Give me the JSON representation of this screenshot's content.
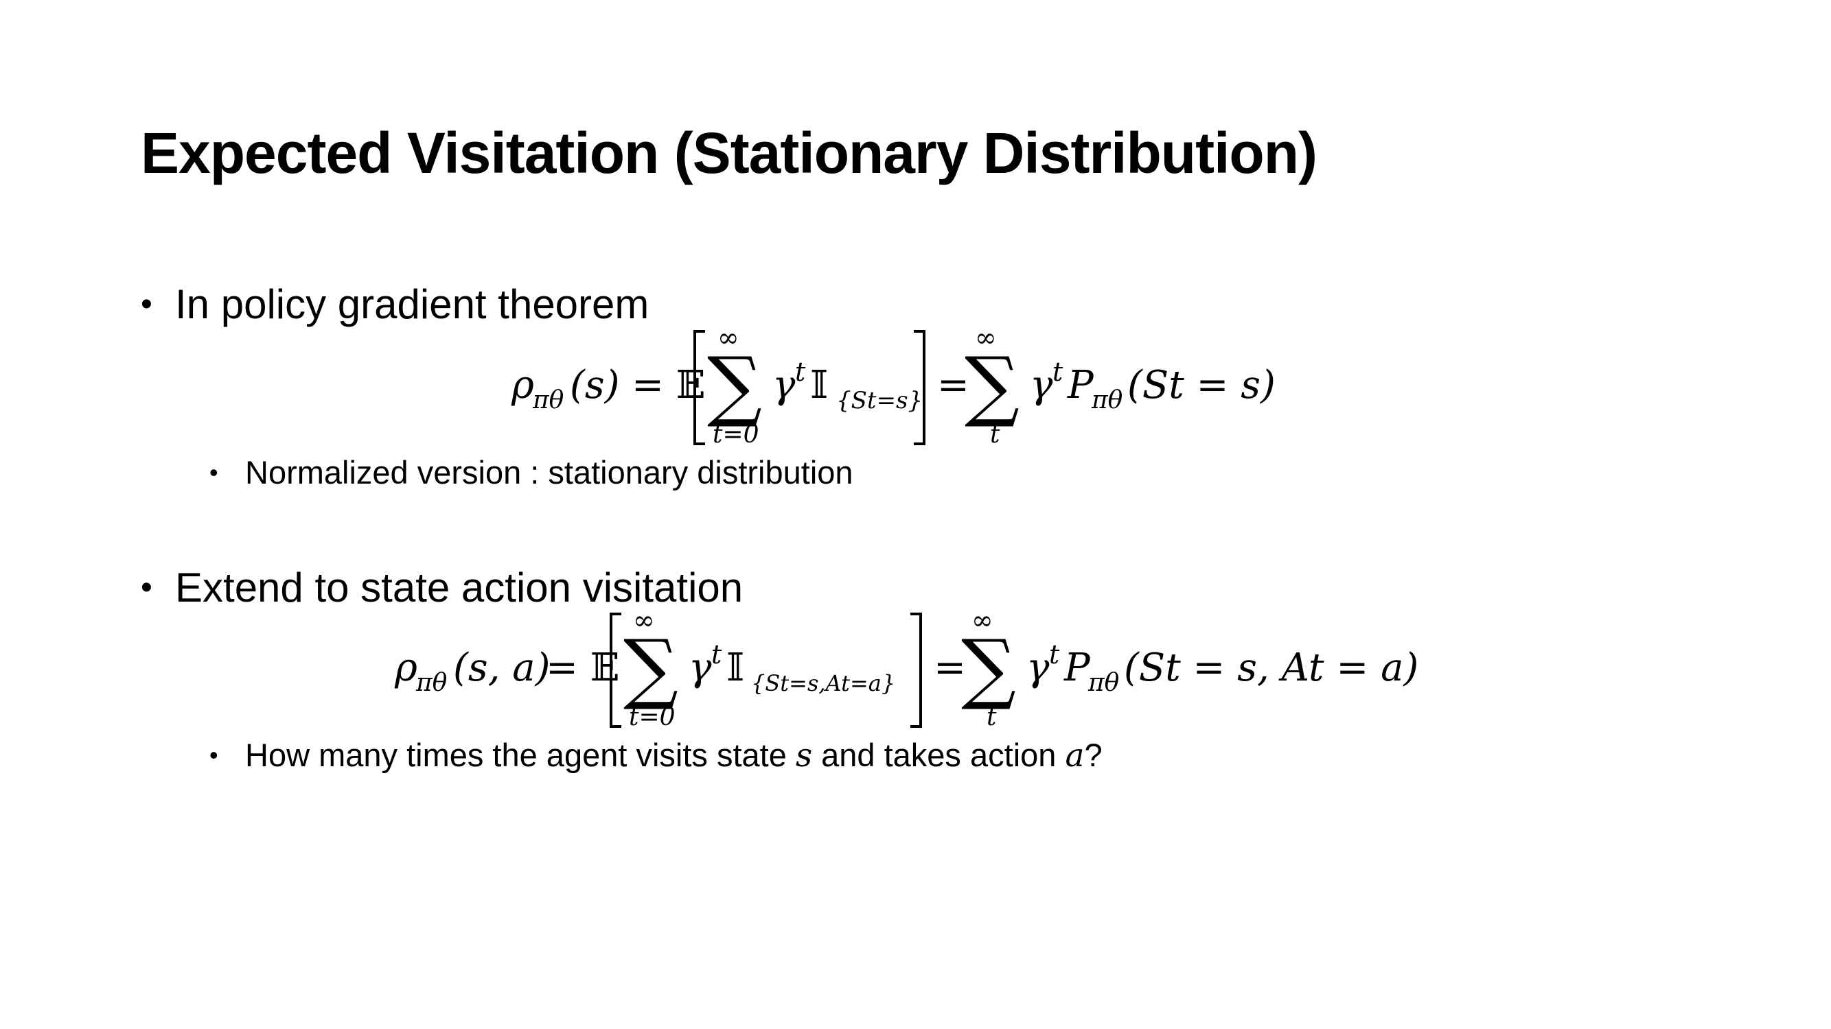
{
  "slide": {
    "title": "Expected Visitation (Stationary Distribution)",
    "bullets": [
      {
        "text": "In policy gradient theorem",
        "sub": {
          "text": "Normalized version : stationary distribution"
        }
      },
      {
        "text": "Extend to state action visitation",
        "sub": {
          "prefix": "How many times the agent visits state ",
          "var1": "s",
          "middle": " and takes action ",
          "var2": "a",
          "suffix": "?"
        }
      }
    ],
    "equations": {
      "eq1": {
        "lhs_rho": "ρ",
        "lhs_sub": "πθ",
        "lhs_args": "(s)",
        "expect": "= 𝔼",
        "sum_upper": "∞",
        "sum_lower": "t=0",
        "term": "γ",
        "term_sup": "t",
        "indicator": "𝕀",
        "indicator_sub": "{St=s}",
        "eq_sum": "=",
        "sum2_upper": "∞",
        "sum2_lower": "t",
        "rhs_gamma": "γ",
        "rhs_sup": "t",
        "rhs_P": "P",
        "rhs_P_sub": "πθ",
        "rhs_args": "(St = s)"
      },
      "eq2": {
        "lhs_rho": "ρ",
        "lhs_sub": "πθ",
        "lhs_args": "(s, a)",
        "expect": "= 𝔼",
        "sum_upper": "∞",
        "sum_lower": "t=0",
        "term": "γ",
        "term_sup": "t",
        "indicator": "𝕀",
        "indicator_sub": "{St=s,At=a}",
        "eq_sum": "=",
        "sum2_upper": "∞",
        "sum2_lower": "t",
        "rhs_gamma": "γ",
        "rhs_sup": "t",
        "rhs_P": "P",
        "rhs_P_sub": "πθ",
        "rhs_args": "(St = s, At = a)"
      }
    }
  }
}
